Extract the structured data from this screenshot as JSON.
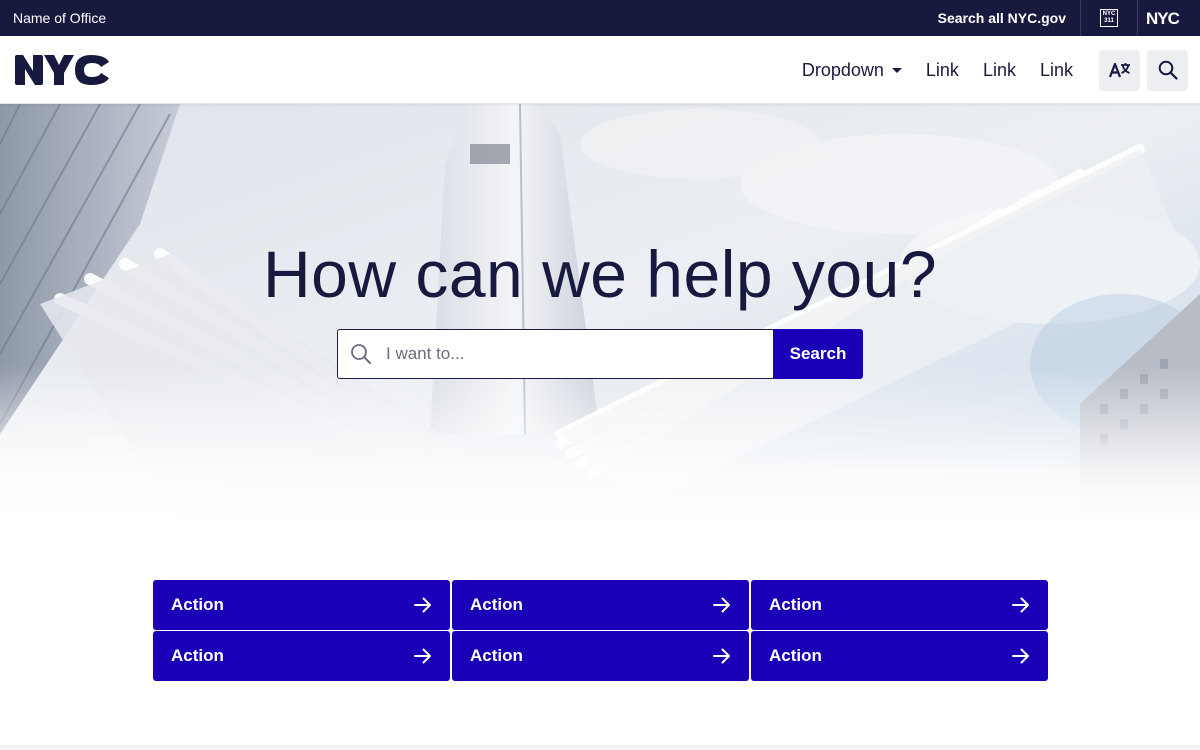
{
  "utility_bar": {
    "office_name": "Name of Office",
    "search_all_label": "Search all NYC.gov",
    "icon_311_text": "NYC 311",
    "icons": [
      "nyc-311-icon",
      "nyc-logo-icon"
    ]
  },
  "header": {
    "logo_alt": "NYC",
    "nav": {
      "dropdown_label": "Dropdown",
      "links": [
        "Link",
        "Link",
        "Link"
      ]
    },
    "icons": [
      "translate-icon",
      "search-icon"
    ]
  },
  "hero": {
    "title": "How can we help you?",
    "search": {
      "placeholder": "I want to...",
      "value": "",
      "button_label": "Search"
    }
  },
  "actions": [
    {
      "label": "Action"
    },
    {
      "label": "Action"
    },
    {
      "label": "Action"
    },
    {
      "label": "Action"
    },
    {
      "label": "Action"
    },
    {
      "label": "Action"
    }
  ],
  "colors": {
    "utility_bg": "#171a3e",
    "primary_button": "#1a00b6",
    "text_dark": "#171a3e",
    "icon_button_bg": "#eceef2"
  }
}
